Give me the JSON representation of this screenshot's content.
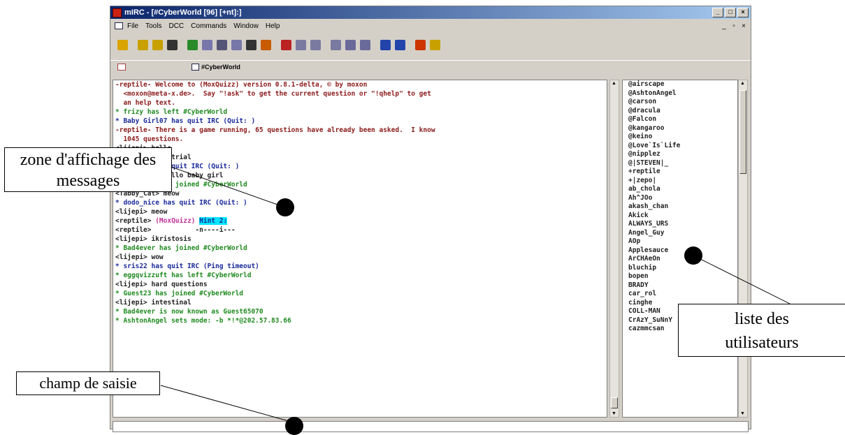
{
  "window": {
    "title": "mIRC - [#CyberWorld [96] [+nt]:]",
    "controls": [
      "_",
      "□",
      "×"
    ]
  },
  "menubar": {
    "items": [
      "File",
      "Tools",
      "DCC",
      "Commands",
      "Window",
      "Help"
    ],
    "child_controls": [
      "_",
      "▫",
      "×"
    ]
  },
  "toolbar": {
    "icons": [
      "connect-icon",
      "options-icon",
      "folder-icon",
      "address-book-icon",
      "channels-list-icon",
      "dcc-send-icon",
      "dcc-chat-icon",
      "notify-icon",
      "timer-icon",
      "colors-icon",
      "channel-icon",
      "cascade-icon",
      "tile-icon",
      "arrange-icon",
      "window-1-icon",
      "window-2-icon",
      "list-icon",
      "list-2-icon",
      "help-icon",
      "about-icon"
    ],
    "colors": [
      "#d9a400",
      "#c8a000",
      "#c8a000",
      "#333333",
      "#2a8a2a",
      "#7777aa",
      "#555577",
      "#7777aa",
      "#333333",
      "#c85a00",
      "#bb2222",
      "#7a7aa0",
      "#7a7aa0",
      "#7a7aa0",
      "#6a6a9a",
      "#6a6a9a",
      "#2244aa",
      "#2244aa",
      "#cc3300",
      "#c8a000"
    ]
  },
  "switchbar": {
    "channel": "#CyberWorld"
  },
  "messages": [
    {
      "text": "-reptile- Welcome to (MoxQuizz) version 0.8.1-delta, © by moxon",
      "color": "#8b1a1a"
    },
    {
      "text": "  <moxon@meta-x.de>.  Say \"!ask\" to get the current question or \"!qhelp\" to get",
      "color": "#8b1a1a"
    },
    {
      "text": "  an help text.",
      "color": "#8b1a1a"
    },
    {
      "text": "* frizy has left #CyberWorld",
      "color": "#1f8a1f"
    },
    {
      "text": "* Baby Girl07 has quit IRC (Quit: )",
      "color": "#1a2a9a"
    },
    {
      "text": "-reptile- There is a game running, 65 questions have already been asked.  I know",
      "color": "#8b1a1a"
    },
    {
      "text": "  1045 questions.",
      "color": "#8b1a1a"
    },
    {
      "text": "<lijepi> hello",
      "color": "#222222"
    },
    {
      "text": "<lijepi> industrial",
      "color": "#222222"
    },
    {
      "text": "* Atin255 has quit IRC (Quit: )",
      "color": "#1a2a9a"
    },
    {
      "text": "<dodo_nice> hello baby girl",
      "color": "#222222"
    },
    {
      "text": "* TracyG15 has joined #CyberWorld",
      "color": "#1f8a1f"
    },
    {
      "text": "<Tabby_Cat> meow",
      "color": "#222222"
    },
    {
      "text": "* dodo_nice has quit IRC (Quit: )",
      "color": "#1a2a9a"
    },
    {
      "text": "<lijepi> meow",
      "color": "#222222"
    },
    {
      "text": "<reptile> (MoxQuizz) ",
      "color": "#222222",
      "extra": "Hint 2:"
    },
    {
      "text": "<reptile>           -n----i---",
      "color": "#222222"
    },
    {
      "text": "<lijepi> ikristosis",
      "color": "#222222"
    },
    {
      "text": "* Bad4ever has joined #CyberWorld",
      "color": "#1f8a1f"
    },
    {
      "text": "<lijepi> wow",
      "color": "#222222"
    },
    {
      "text": "* sris22 has quit IRC (Ping timeout)",
      "color": "#1a2a9a"
    },
    {
      "text": "* eggqvizzuft has left #CyberWorld",
      "color": "#1f8a1f"
    },
    {
      "text": "<lijepi> hard questions",
      "color": "#222222"
    },
    {
      "text": "* Guest23 has joined #CyberWorld",
      "color": "#1f8a1f"
    },
    {
      "text": "<lijepi> intestinal",
      "color": "#222222"
    },
    {
      "text": "* Bad4ever is now known as Guest65070",
      "color": "#1f8a1f"
    },
    {
      "text": "* AshtonAngel sets mode: -b *!*@202.57.83.66",
      "color": "#1f8a1f"
    }
  ],
  "hint_highlight_color": "#00e5ff",
  "moxquizz_color": "#c0309a",
  "nicklist": [
    "@airscape",
    "@AshtonAngel",
    "@carson",
    "@dracula",
    "@Falcon",
    "@kangaroo",
    "@keino",
    "@Love`Is`Life",
    "@nipplez",
    "@|STEVEN|_",
    "+reptile",
    "+|zepo|",
    "ab_chola",
    "Ah^JOo",
    "akash_chan",
    "Akick",
    "ALWAYS_URS",
    "Angel_Guy",
    "AOp",
    "Applesauce",
    "ArCHAeOn",
    "bluchip",
    "bopen",
    "BRADY",
    "car_rol",
    "cinghe",
    "COLL-MAN",
    "CrAzY_SuNnY",
    "cazmmcsan"
  ],
  "annotations": {
    "messages_zone": "zone d'affichage des messages",
    "users_list": "liste des utilisateurs",
    "input_field": "champ de saisie"
  }
}
